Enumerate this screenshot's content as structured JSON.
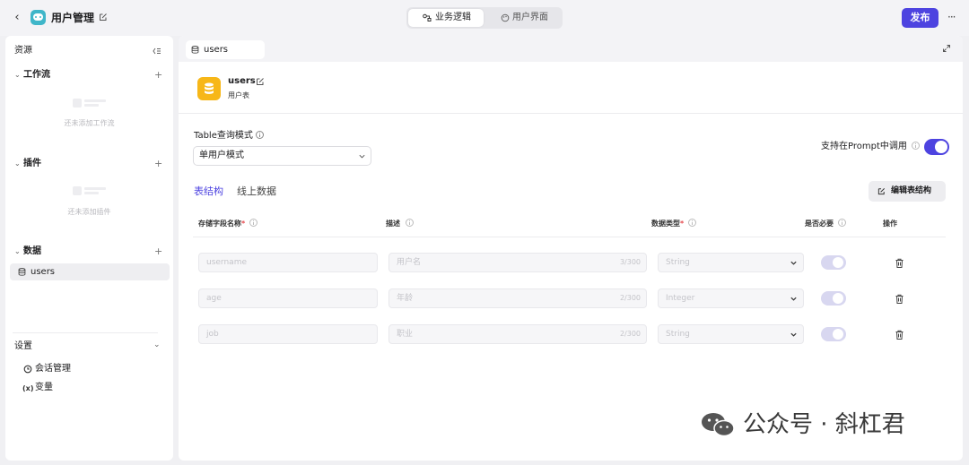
{
  "header": {
    "app_title": "用户管理",
    "mode_tabs": [
      {
        "label": "业务逻辑",
        "active": true
      },
      {
        "label": "用户界面",
        "active": false
      }
    ],
    "publish_label": "发布",
    "more_label": "···",
    "accent_color": "#4d43e0"
  },
  "sidebar": {
    "title": "资源",
    "sections": {
      "workflow": {
        "label": "工作流",
        "empty_text": "还未添加工作流"
      },
      "plugins": {
        "label": "插件",
        "empty_text": "还未添加插件"
      },
      "data": {
        "label": "数据",
        "items": [
          {
            "label": "users",
            "icon": "database-icon"
          }
        ]
      }
    },
    "settings": {
      "label": "设置",
      "items": [
        {
          "label": "会话管理",
          "icon": "chat-manage-icon"
        },
        {
          "label": "变量",
          "icon": "variable-icon",
          "glyph": "(x)"
        }
      ]
    }
  },
  "main": {
    "file_tab": "users",
    "table": {
      "name": "users",
      "description": "用户表",
      "icon_color": "#f7b718"
    },
    "query_mode": {
      "label": "Table查询模式",
      "value": "单用户模式"
    },
    "prompt_support": {
      "label": "支持在Prompt中调用",
      "enabled": true
    },
    "subtabs": [
      {
        "label": "表结构",
        "active": true
      },
      {
        "label": "线上数据",
        "active": false
      }
    ],
    "edit_structure_label": "编辑表结构",
    "columns": {
      "field_name": "存储字段名称",
      "description": "描述",
      "data_type": "数据类型",
      "required": "是否必要",
      "actions": "操作",
      "required_mark": "*"
    },
    "rows": [
      {
        "name": "username",
        "description": "用户名",
        "count": "3/300",
        "type": "String",
        "required": true
      },
      {
        "name": "age",
        "description": "年龄",
        "count": "2/300",
        "type": "Integer",
        "required": true
      },
      {
        "name": "job",
        "description": "职业",
        "count": "2/300",
        "type": "String",
        "required": true
      }
    ]
  },
  "watermark": {
    "text": "公众号 · 斜杠君"
  }
}
